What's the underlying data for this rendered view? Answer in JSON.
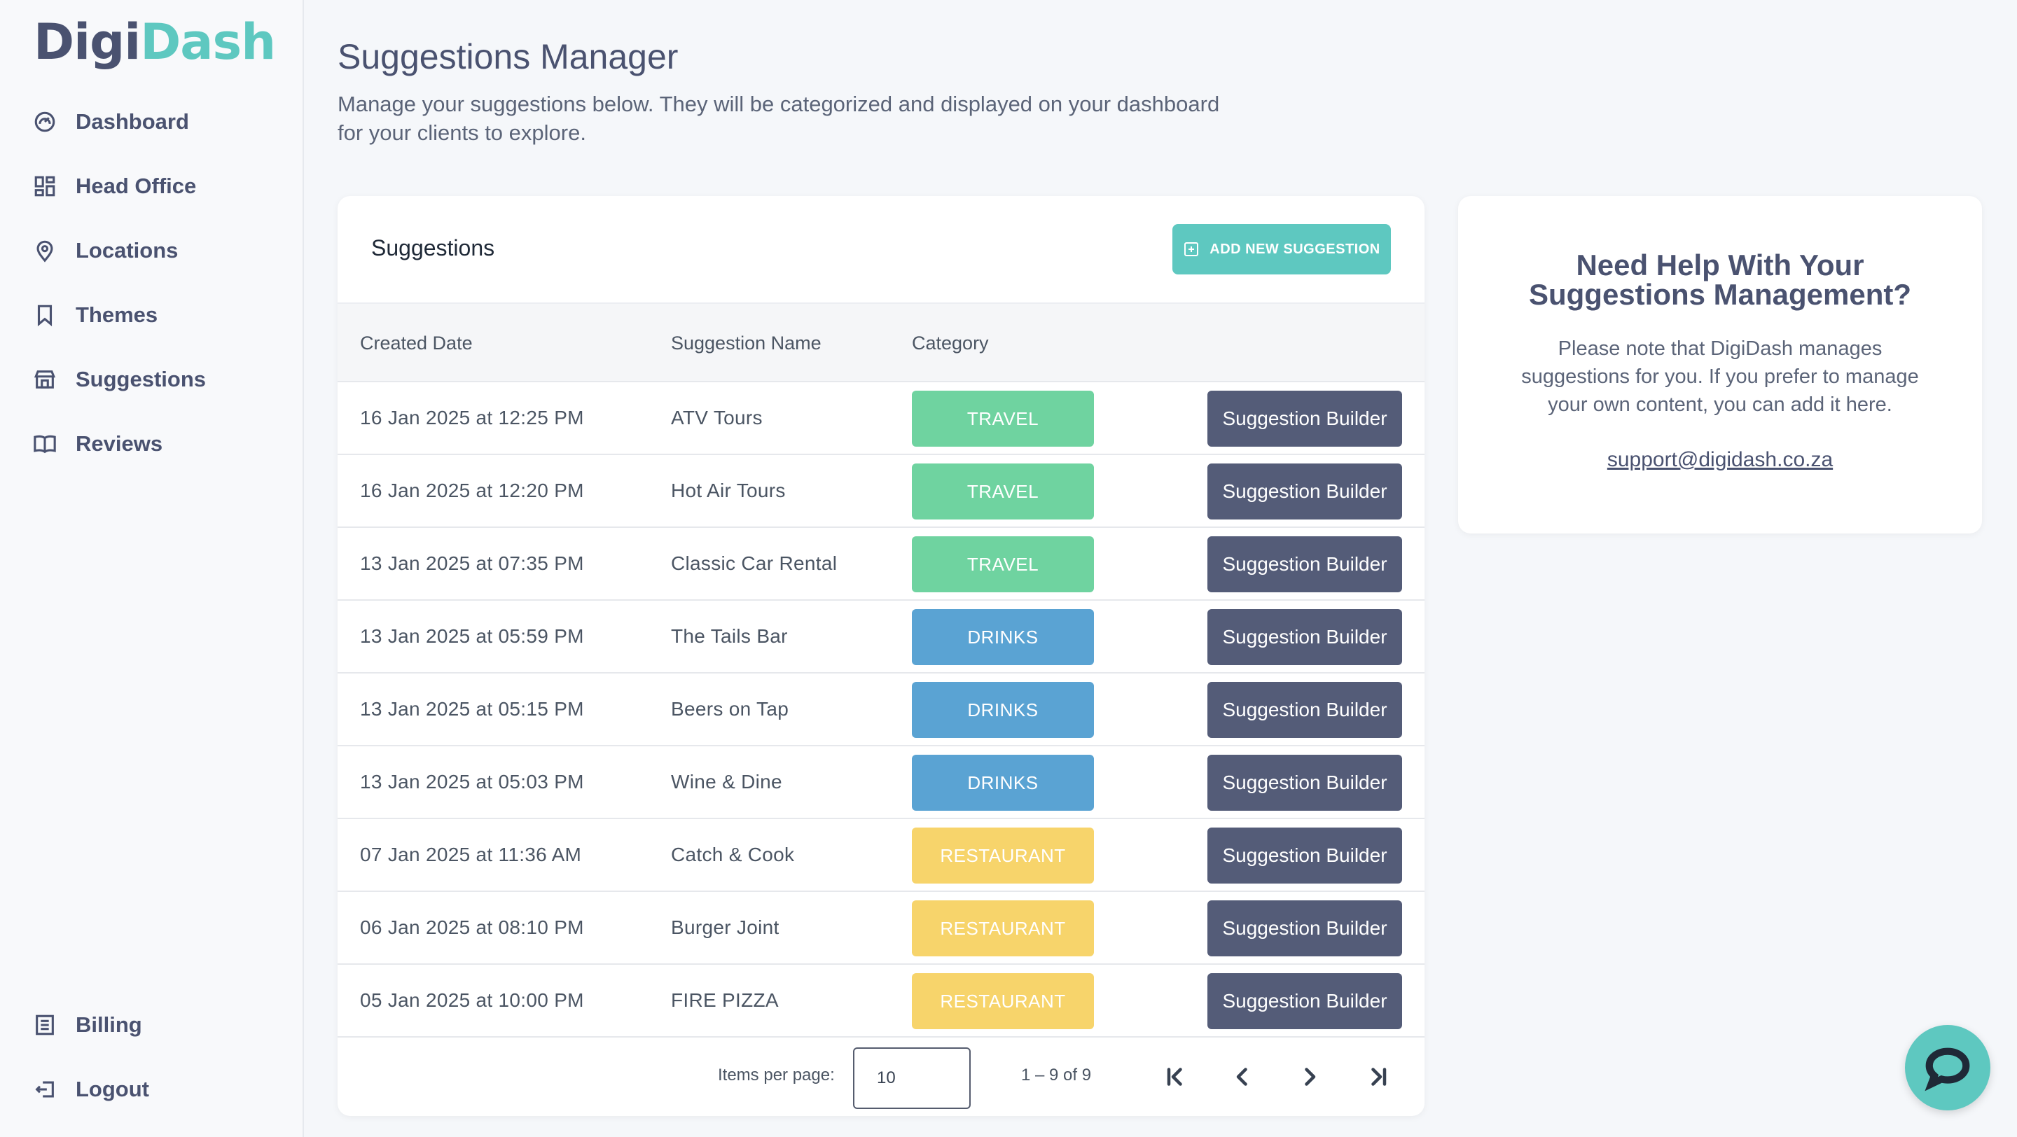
{
  "brand": {
    "part1": "Digi",
    "part2": "Dash"
  },
  "sidebar": {
    "items": [
      {
        "label": "Dashboard",
        "icon": "dashboard-gauge-icon"
      },
      {
        "label": "Head Office",
        "icon": "grid-icon"
      },
      {
        "label": "Locations",
        "icon": "location-pin-icon"
      },
      {
        "label": "Themes",
        "icon": "bookmark-icon"
      },
      {
        "label": "Suggestions",
        "icon": "store-icon"
      },
      {
        "label": "Reviews",
        "icon": "book-icon"
      }
    ],
    "bottom": [
      {
        "label": "Billing",
        "icon": "receipt-icon"
      },
      {
        "label": "Logout",
        "icon": "logout-icon"
      }
    ]
  },
  "header": {
    "title": "Suggestions Manager",
    "description": "Manage your suggestions below. They will be categorized and displayed on your dashboard for your clients to explore."
  },
  "suggestions": {
    "title": "Suggestions",
    "add_button": "ADD NEW SUGGESTION",
    "columns": [
      "Created Date",
      "Suggestion Name",
      "Category"
    ],
    "builder_label": "Suggestion Builder",
    "rows": [
      {
        "date": "16 Jan 2025 at 12:25 PM",
        "name": "ATV Tours",
        "category": "TRAVEL"
      },
      {
        "date": "16 Jan 2025 at 12:20 PM",
        "name": "Hot Air Tours",
        "category": "TRAVEL"
      },
      {
        "date": "13 Jan 2025 at 07:35 PM",
        "name": "Classic Car Rental",
        "category": "TRAVEL"
      },
      {
        "date": "13 Jan 2025 at 05:59 PM",
        "name": "The Tails Bar",
        "category": "DRINKS"
      },
      {
        "date": "13 Jan 2025 at 05:15 PM",
        "name": "Beers on Tap",
        "category": "DRINKS"
      },
      {
        "date": "13 Jan 2025 at 05:03 PM",
        "name": "Wine & Dine",
        "category": "DRINKS"
      },
      {
        "date": "07 Jan 2025 at 11:36 AM",
        "name": "Catch & Cook",
        "category": "RESTAURANT"
      },
      {
        "date": "06 Jan 2025 at 08:10 PM",
        "name": "Burger Joint",
        "category": "RESTAURANT"
      },
      {
        "date": "05 Jan 2025 at 10:00 PM",
        "name": "FIRE PIZZA",
        "category": "RESTAURANT"
      }
    ],
    "category_colors": {
      "TRAVEL": "#6fd3a0",
      "DRINKS": "#5aa3d3",
      "RESTAURANT": "#f7d46b"
    }
  },
  "pagination": {
    "items_per_page_label": "Items per page:",
    "items_per_page": "10",
    "range": "1 – 9 of 9"
  },
  "help": {
    "title": "Need Help With Your Suggestions Management?",
    "body": "Please note that DigiDash manages suggestions for you. If you prefer to manage your own content, you can add it here.",
    "email": "support@digidash.co.za"
  },
  "colors": {
    "accent": "#5ec8c0",
    "dark": "#545c78"
  }
}
